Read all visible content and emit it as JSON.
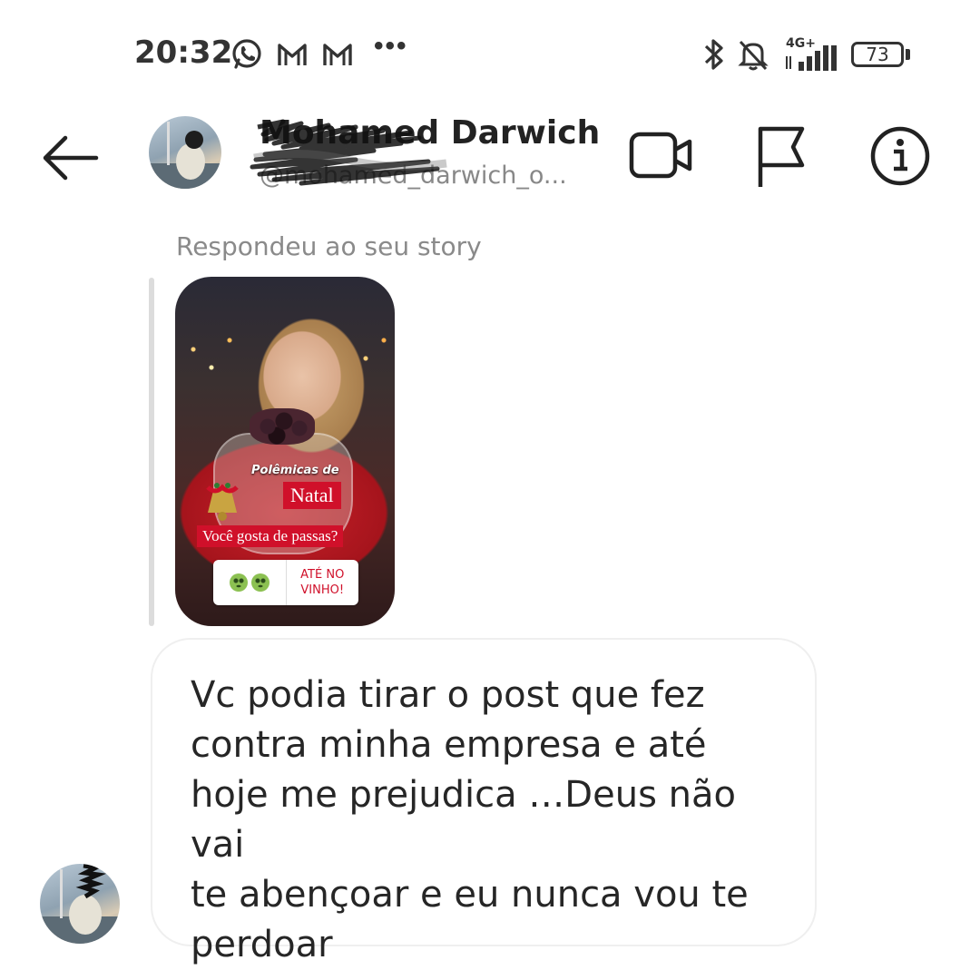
{
  "status_bar": {
    "time": "20:32",
    "network": "4G+",
    "battery": "73",
    "icons": [
      "whatsapp-icon",
      "gmail-icon",
      "gmail-icon",
      "more-dots-icon",
      "bluetooth-icon",
      "notifications-off-icon",
      "signal-icon",
      "battery-icon"
    ],
    "more": "•••"
  },
  "header": {
    "name": "Mohamed Darwich",
    "username": "@mohamed_darwich_o...",
    "icons": [
      "back-arrow-icon",
      "video-call-icon",
      "flag-icon",
      "info-icon"
    ]
  },
  "thread": {
    "reply_label": "Respondeu ao seu story",
    "story": {
      "title_small": "Polêmicas de",
      "title_big": "Natal",
      "question": "Você gosta de passas?",
      "poll_option_b": "ATÉ NO\nVINHO!"
    },
    "message": "Vc podia tirar o post que fez\ncontra minha empresa e até\nhoje me prejudica …Deus não vai\nte abençoar e eu nunca vou te\nperdoar"
  },
  "colors": {
    "accent_red": "#d0102a",
    "text_primary": "#262626",
    "text_secondary": "#8a8a8a",
    "bubble_border": "#efefef"
  }
}
